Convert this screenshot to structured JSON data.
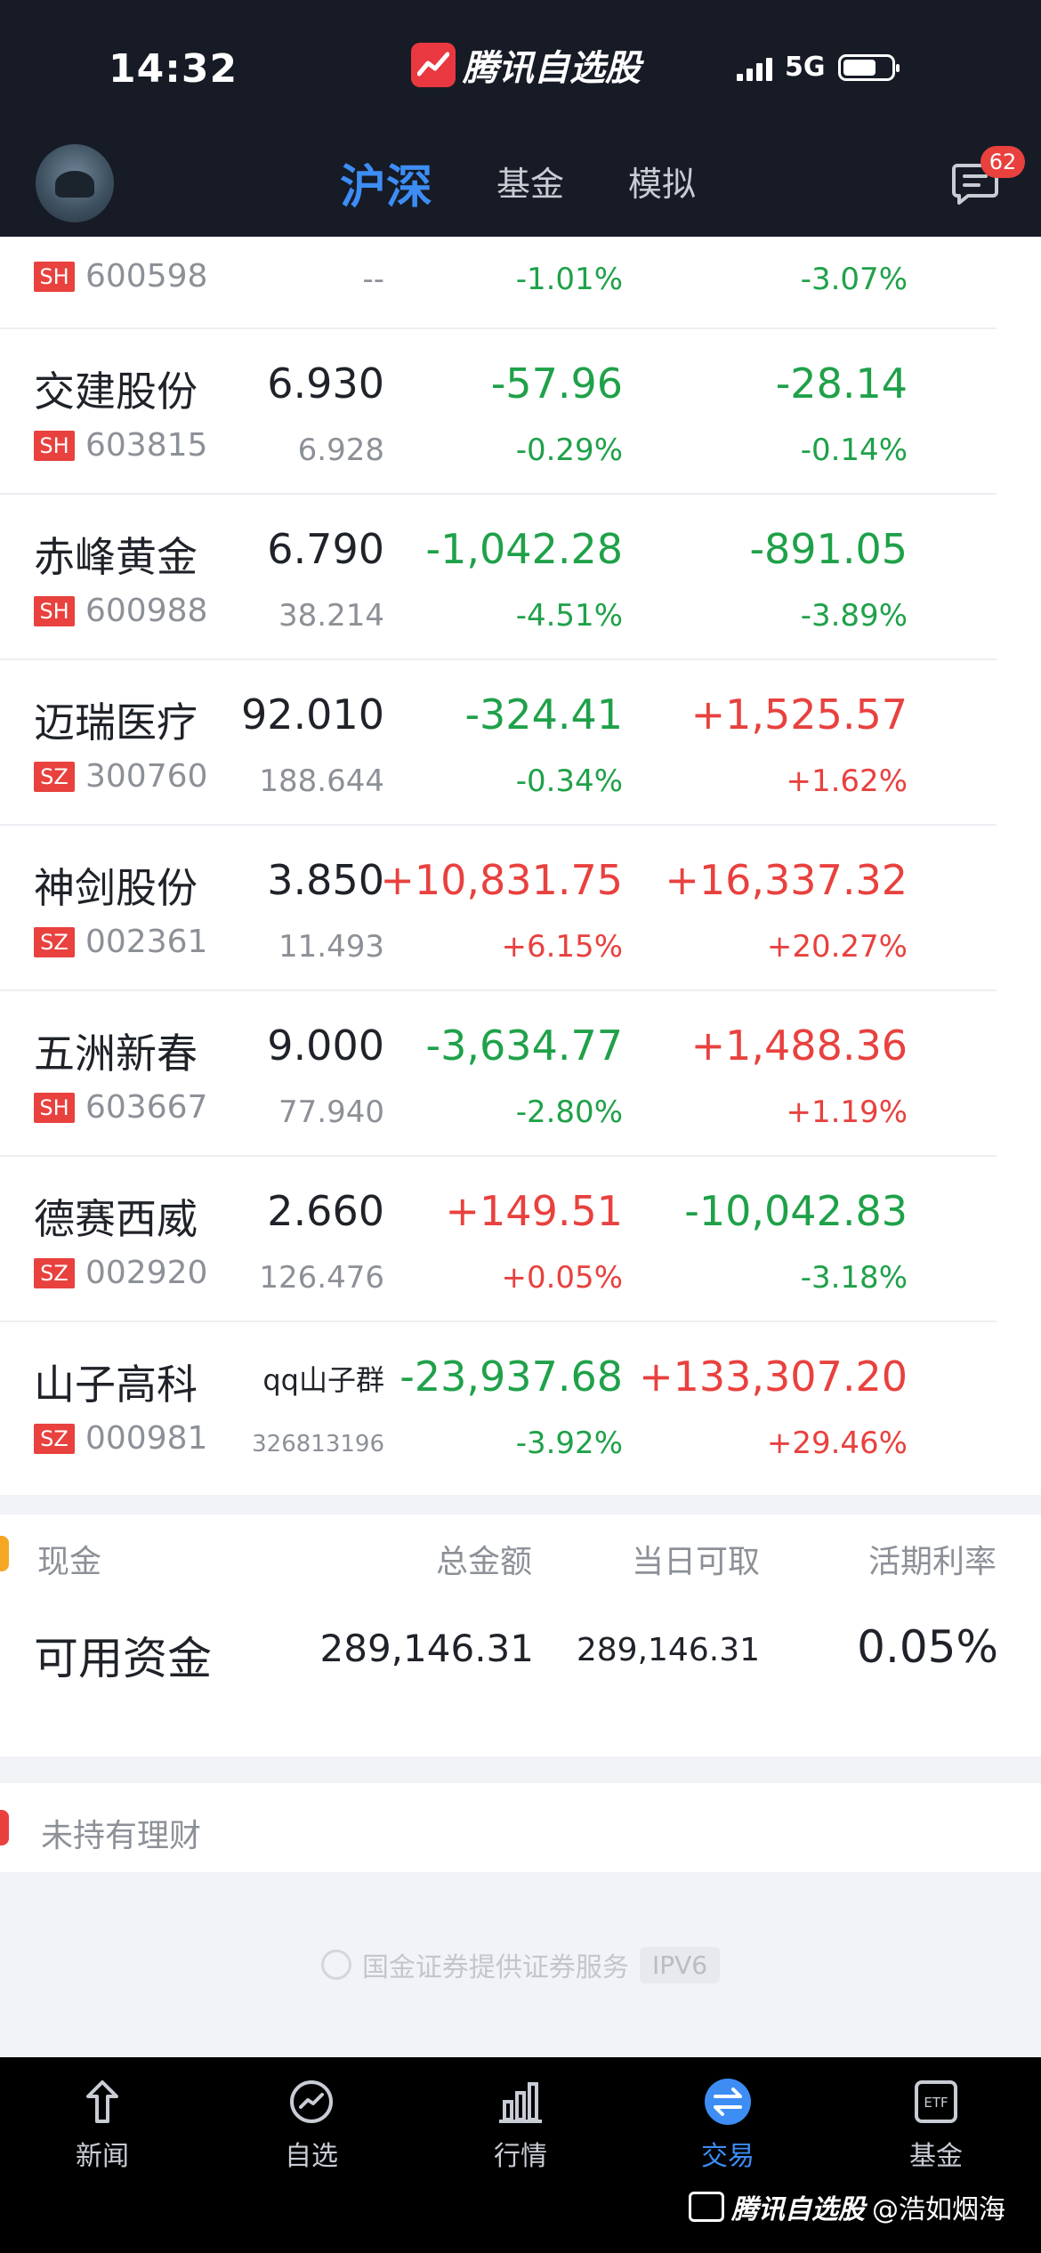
{
  "status_bar": {
    "time": "14:32",
    "network": "5G"
  },
  "app": {
    "name": "腾讯自选股"
  },
  "nav": {
    "tabs": [
      {
        "label": "沪深"
      },
      {
        "label": "基金"
      },
      {
        "label": "模拟"
      }
    ],
    "active_tab": "沪深",
    "message_badge": "62"
  },
  "holdings": [
    {
      "name": "",
      "market": "SH",
      "code": "600598",
      "price": "",
      "cost": "--",
      "pnl_today": "",
      "pnl_today_pct": "-1.01%",
      "pnl_total": "",
      "pnl_total_pct": "-3.07%"
    },
    {
      "name": "交建股份",
      "market": "SH",
      "code": "603815",
      "price": "6.930",
      "cost": "6.928",
      "pnl_today": "-57.96",
      "pnl_today_pct": "-0.29%",
      "pnl_total": "-28.14",
      "pnl_total_pct": "-0.14%"
    },
    {
      "name": "赤峰黄金",
      "market": "SH",
      "code": "600988",
      "price": "6.790",
      "cost": "38.214",
      "pnl_today": "-1,042.28",
      "pnl_today_pct": "-4.51%",
      "pnl_total": "-891.05",
      "pnl_total_pct": "-3.89%"
    },
    {
      "name": "迈瑞医疗",
      "market": "SZ",
      "code": "300760",
      "price": "92.010",
      "cost": "188.644",
      "pnl_today": "-324.41",
      "pnl_today_pct": "-0.34%",
      "pnl_total": "+1,525.57",
      "pnl_total_pct": "+1.62%"
    },
    {
      "name": "神剑股份",
      "market": "SZ",
      "code": "002361",
      "price": "3.850",
      "cost": "11.493",
      "pnl_today": "+10,831.75",
      "pnl_today_pct": "+6.15%",
      "pnl_total": "+16,337.32",
      "pnl_total_pct": "+20.27%"
    },
    {
      "name": "五洲新春",
      "market": "SH",
      "code": "603667",
      "price": "9.000",
      "cost": "77.940",
      "pnl_today": "-3,634.77",
      "pnl_today_pct": "-2.80%",
      "pnl_total": "+1,488.36",
      "pnl_total_pct": "+1.19%"
    },
    {
      "name": "德赛西威",
      "market": "SZ",
      "code": "002920",
      "price": "2.660",
      "cost": "126.476",
      "pnl_today": "+149.51",
      "pnl_today_pct": "+0.05%",
      "pnl_total": "-10,042.83",
      "pnl_total_pct": "-3.18%"
    },
    {
      "name": "山子高科",
      "market": "SZ",
      "code": "000981",
      "price": "qq山子群",
      "cost": "326813196",
      "pnl_today": "-23,937.68",
      "pnl_today_pct": "-3.92%",
      "pnl_total": "+133,307.20",
      "pnl_total_pct": "+29.46%"
    }
  ],
  "colors": {
    "up": "#e8413e",
    "down": "#1fa149",
    "accent": "#3d8df5"
  },
  "cash": {
    "title": "现金",
    "headers": [
      "总金额",
      "当日可取",
      "活期利率"
    ],
    "row_label": "可用资金",
    "total": "289,146.31",
    "withdrawable": "289,146.31",
    "rate": "0.05%"
  },
  "wealth": {
    "text": "未持有理财"
  },
  "footer": {
    "note": "国金证券提供证券服务",
    "badge": "IPV6"
  },
  "bottom_nav": {
    "items": [
      {
        "label": "新闻",
        "icon": "news-icon"
      },
      {
        "label": "自选",
        "icon": "watchlist-icon"
      },
      {
        "label": "行情",
        "icon": "market-icon"
      },
      {
        "label": "交易",
        "icon": "trade-icon"
      },
      {
        "label": "基金",
        "icon": "etf-icon"
      }
    ],
    "active": "交易"
  },
  "watermark": {
    "brand": "腾讯自选股",
    "user": "@浩如烟海"
  }
}
